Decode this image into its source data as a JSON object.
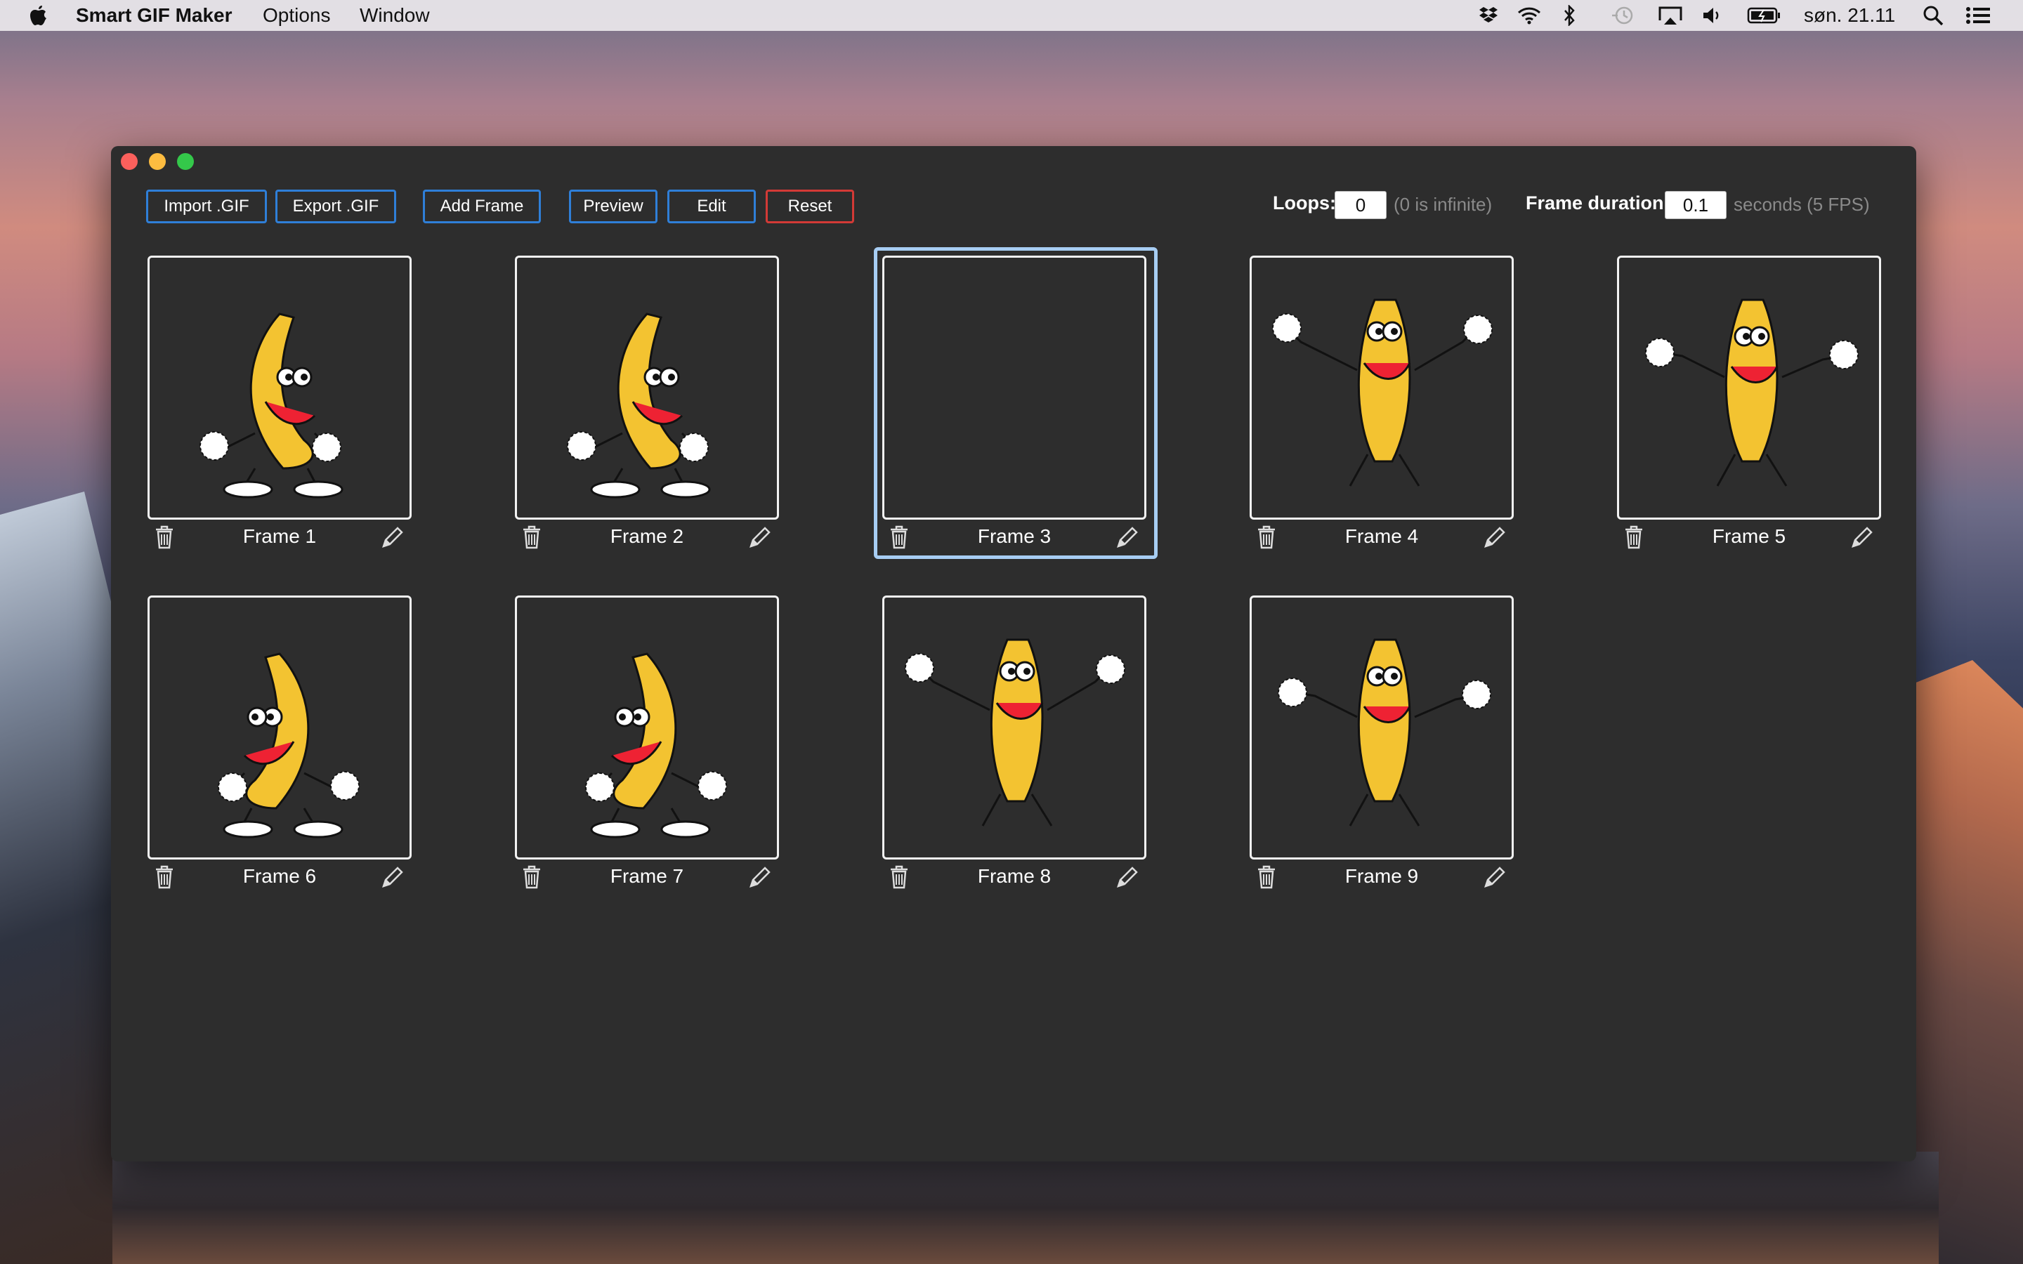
{
  "menubar": {
    "app_name": "Smart GIF Maker",
    "menus": [
      "Options",
      "Window"
    ],
    "clock": "søn. 21.11",
    "status_icons": [
      "dropbox-icon",
      "wifi-icon",
      "bluetooth-icon",
      "time-machine-icon",
      "airplay-icon",
      "volume-icon",
      "battery-icon",
      "spotlight-icon",
      "notification-center-icon"
    ]
  },
  "toolbar": {
    "import_label": "Import .GIF",
    "export_label": "Export .GIF",
    "add_frame_label": "Add Frame",
    "preview_label": "Preview",
    "edit_label": "Edit",
    "reset_label": "Reset",
    "loops_label": "Loops:",
    "loops_value": "0",
    "loops_hint": "(0 is infinite)",
    "duration_label": "Frame duration:",
    "duration_value": "0.1",
    "duration_hint": "seconds (5 FPS)"
  },
  "frames": [
    {
      "label": "Frame 1",
      "pose": "lean-right",
      "selected": false
    },
    {
      "label": "Frame 2",
      "pose": "lean-right",
      "selected": false
    },
    {
      "label": "Frame 3",
      "pose": "empty",
      "selected": true
    },
    {
      "label": "Frame 4",
      "pose": "arms-up",
      "selected": false
    },
    {
      "label": "Frame 5",
      "pose": "arms-out",
      "selected": false
    },
    {
      "label": "Frame 6",
      "pose": "lean-left",
      "selected": false
    },
    {
      "label": "Frame 7",
      "pose": "lean-left",
      "selected": false
    },
    {
      "label": "Frame 8",
      "pose": "arms-up",
      "selected": false
    },
    {
      "label": "Frame 9",
      "pose": "arms-out",
      "selected": false
    }
  ],
  "colors": {
    "window_bg": "#2d2d2d",
    "button_border": "#2f7fd8",
    "reset_border": "#d33a36",
    "selection": "#a7cdf3",
    "banana": "#f3c331"
  }
}
